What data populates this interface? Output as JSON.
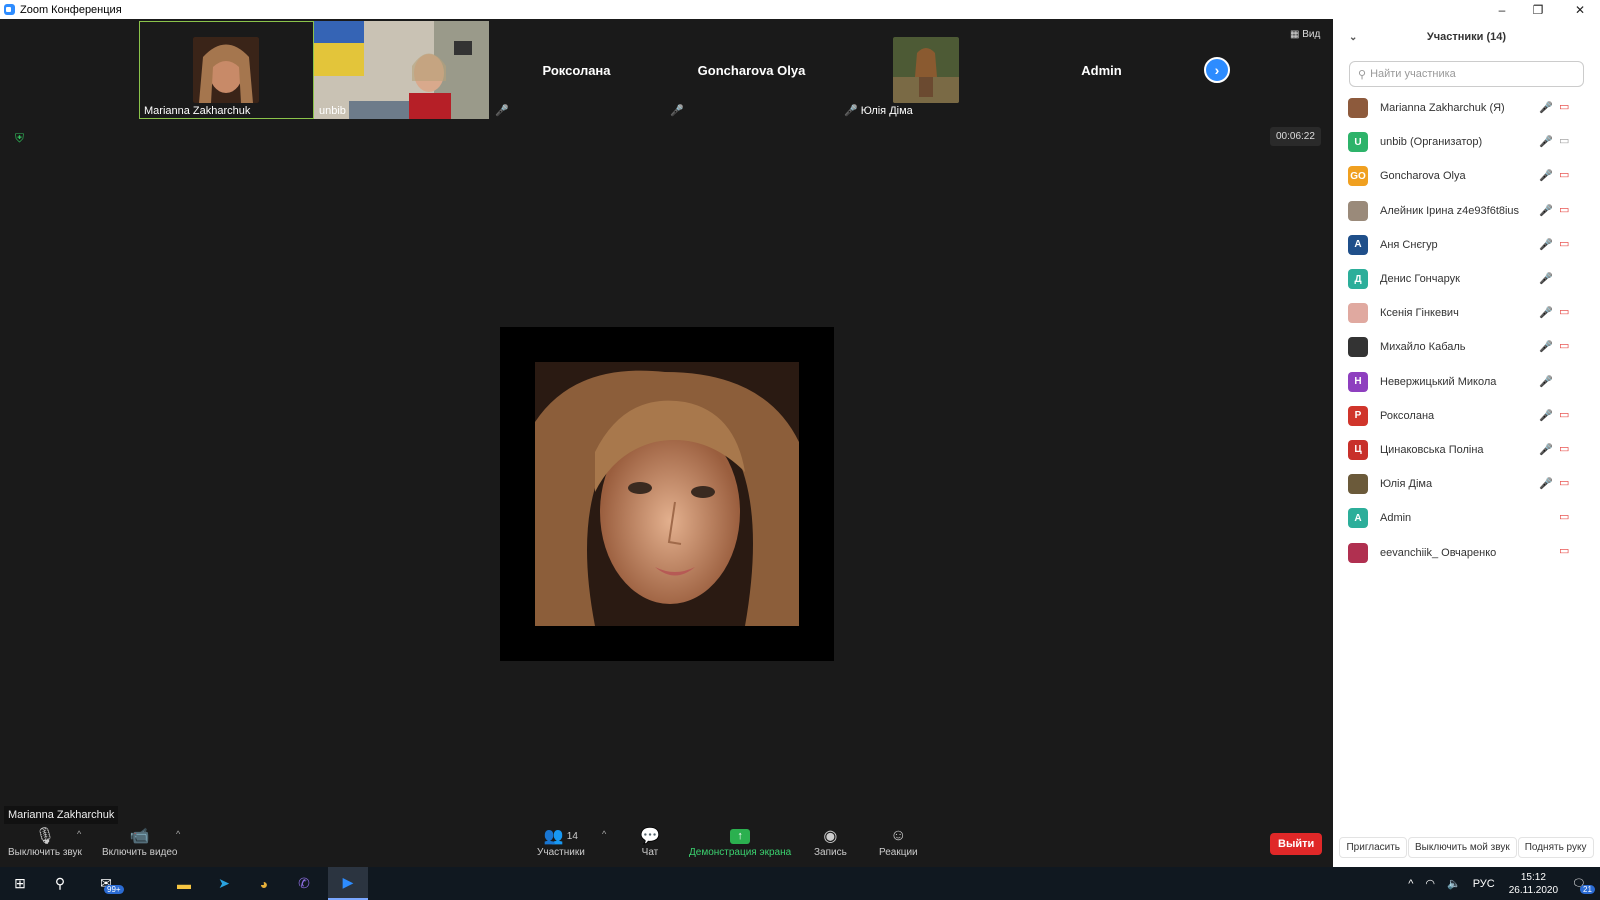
{
  "window": {
    "title": "Zoom Конференция",
    "minimize": "–",
    "restore": "❐",
    "close": "✕"
  },
  "strip": {
    "tiles": [
      {
        "name": "Marianna Zakharchuk",
        "type": "photo",
        "active": true,
        "muted": false
      },
      {
        "name": "unbib",
        "type": "video",
        "active": false,
        "muted": true
      },
      {
        "name": "Роксолана",
        "type": "name",
        "active": false,
        "muted": true
      },
      {
        "name": "Goncharova Olya",
        "type": "name",
        "active": false,
        "muted": true
      },
      {
        "name": "Юлія Діма",
        "type": "photo",
        "active": false,
        "muted": true
      },
      {
        "name": "Admin",
        "type": "name",
        "active": false,
        "muted": false
      }
    ],
    "view_label": "Вид"
  },
  "meeting": {
    "timer": "00:06:22",
    "speaker_name": "Marianna Zakharchuk"
  },
  "toolbar": {
    "mute_label": "Выключить звук",
    "video_label": "Включить видео",
    "participants_label": "Участники",
    "participants_count": "14",
    "chat_label": "Чат",
    "share_label": "Демонстрация экрана",
    "record_label": "Запись",
    "reactions_label": "Реакции",
    "leave_label": "Выйти"
  },
  "panel": {
    "title": "Участники (14)",
    "search_placeholder": "Найти участника",
    "participants": [
      {
        "name": "Marianna Zakharchuk (Я)",
        "initials": "",
        "color": "#8d5a3c",
        "mic": "on",
        "cam": "off"
      },
      {
        "name": "unbib (Организатор)",
        "initials": "U",
        "color": "#2db36a",
        "mic": "on",
        "cam": "on"
      },
      {
        "name": "Goncharova Olya",
        "initials": "GO",
        "color": "#f0a020",
        "mic": "off",
        "cam": "off"
      },
      {
        "name": "Алейник Ірина z4e93f6t8ius",
        "initials": "",
        "color": "#9a8a7a",
        "mic": "off",
        "cam": "off"
      },
      {
        "name": "Аня Снєгур",
        "initials": "А",
        "color": "#1f4f8a",
        "mic": "off",
        "cam": "off"
      },
      {
        "name": "Денис Гончарук",
        "initials": "Д",
        "color": "#2cae9a",
        "mic": "off",
        "cam": ""
      },
      {
        "name": "Ксенія Гінкевич",
        "initials": "",
        "color": "#e0a9a0",
        "mic": "off",
        "cam": "off"
      },
      {
        "name": "Михайло Кабаль",
        "initials": "",
        "color": "#333333",
        "mic": "off",
        "cam": "off"
      },
      {
        "name": "Невержицький Микола",
        "initials": "Н",
        "color": "#8e3fbf",
        "mic": "off",
        "cam": ""
      },
      {
        "name": "Роксолана",
        "initials": "Р",
        "color": "#d0352b",
        "mic": "off",
        "cam": "off"
      },
      {
        "name": "Цинаковська Поліна",
        "initials": "Ц",
        "color": "#c8302a",
        "mic": "off",
        "cam": "off"
      },
      {
        "name": "Юлія Діма",
        "initials": "",
        "color": "#6b5a3a",
        "mic": "off",
        "cam": "off"
      },
      {
        "name": "Admin",
        "initials": "A",
        "color": "#2cae9a",
        "mic": "",
        "cam": "off"
      },
      {
        "name": "eevanchiik_ Овчаренко",
        "initials": "",
        "color": "#b03050",
        "mic": "",
        "cam": "off"
      }
    ],
    "invite_label": "Пригласить",
    "mute_me_label": "Выключить мой звук",
    "raise_hand_label": "Поднять руку"
  },
  "taskbar": {
    "mail_badge": "99+",
    "language": "РУС",
    "time": "15:12",
    "date": "26.11.2020",
    "notifications": "21"
  }
}
